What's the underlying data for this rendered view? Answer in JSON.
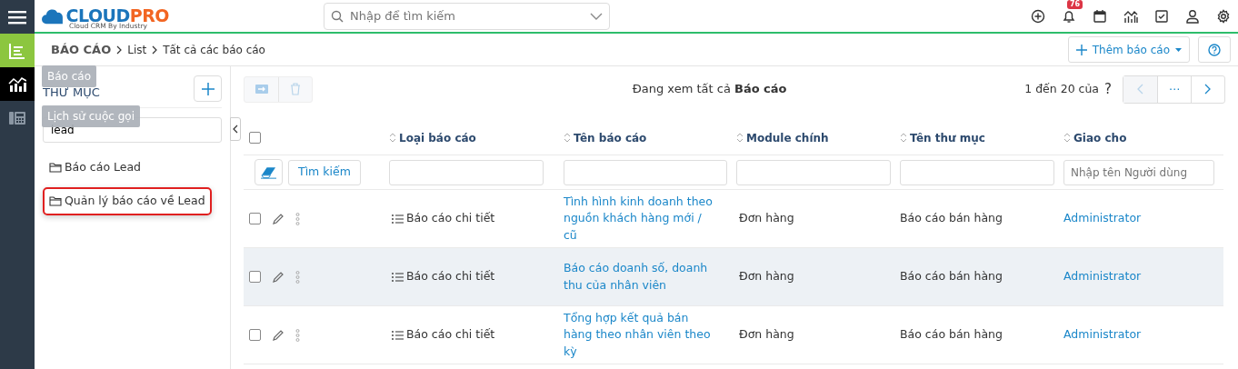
{
  "app": {
    "logo": "CLOUD",
    "logo_accent": "PRO",
    "tagline": "Cloud CRM By Industry"
  },
  "search": {
    "placeholder": "Nhập để tìm kiếm"
  },
  "notifications": {
    "count": "76"
  },
  "rail": [
    {
      "kind": "list",
      "selected": true
    },
    {
      "kind": "chart",
      "selected": false,
      "hovered": true
    },
    {
      "kind": "phone",
      "selected": false,
      "hovered": false
    }
  ],
  "tooltips": [
    "Báo cáo",
    "Lịch sử cuộc gọi"
  ],
  "breadcrumb": {
    "module": "BÁO CÁO",
    "path": [
      "List",
      "Tất cả các báo cáo"
    ]
  },
  "add_button": "Thêm báo cáo",
  "folders": {
    "title": "THƯ MỤC",
    "search_value": "lead",
    "items": [
      {
        "label": "Báo cáo Lead",
        "selected": false
      },
      {
        "label": "Quản lý báo cáo về Lead",
        "selected": true
      }
    ]
  },
  "list": {
    "caption": "Đang xem tất cả **Báo cáo**",
    "range": "1 đến 20 của",
    "total": "?",
    "more": "⋯"
  },
  "columns": [
    "Loại báo cáo",
    "Tên báo cáo",
    "Module chính",
    "Tên thư mục",
    "Giao cho"
  ],
  "select_all": {
    "checked": false
  },
  "filter": {
    "search_button": "Tìm kiếm",
    "assignee_placeholder": "Nhập tên Người dùng"
  },
  "rows": [
    {
      "checked": false,
      "highlighted": false,
      "type": "Báo cáo chi tiết",
      "name": "Tình hình kinh doanh theo nguồn khách hàng mới / cũ",
      "module": "Đơn hàng",
      "folder": "Báo cáo bán hàng",
      "assignee": "Administrator"
    },
    {
      "checked": false,
      "highlighted": true,
      "type": "Báo cáo chi tiết",
      "name": "Báo cáo doanh số, doanh thu của nhân viên",
      "module": "Đơn hàng",
      "folder": "Báo cáo bán hàng",
      "assignee": "Administrator"
    },
    {
      "checked": false,
      "highlighted": false,
      "type": "Báo cáo chi tiết",
      "name": "Tổng hợp kết quả bán hàng theo nhân viên theo kỳ",
      "module": "Đơn hàng",
      "folder": "Báo cáo bán hàng",
      "assignee": "Administrator"
    }
  ]
}
